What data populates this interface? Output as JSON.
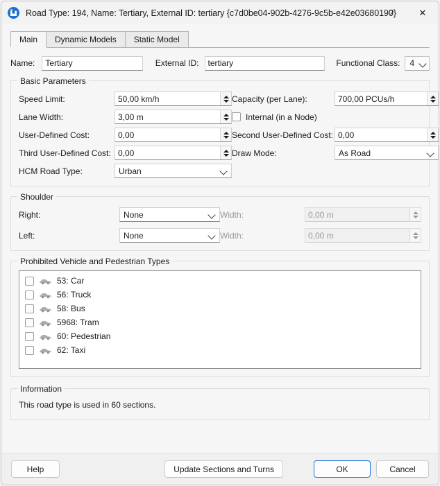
{
  "window": {
    "title": "Road Type: 194, Name: Tertiary, External ID: tertiary  {c7d0be04-902b-4276-9c5b-e42e03680190}",
    "app_icon": "aimsun-app-icon",
    "help_button": "?",
    "close_button": "✕"
  },
  "tabs": [
    {
      "label": "Main",
      "active": true
    },
    {
      "label": "Dynamic Models",
      "active": false
    },
    {
      "label": "Static Model",
      "active": false
    }
  ],
  "top_row": {
    "name_label": "Name:",
    "name_value": "Tertiary",
    "external_id_label": "External ID:",
    "external_id_value": "tertiary",
    "functional_class_label": "Functional Class:",
    "functional_class_value": "4"
  },
  "basic_parameters": {
    "title": "Basic Parameters",
    "speed_limit_label": "Speed Limit:",
    "speed_limit_value": "50,00 km/h",
    "capacity_label": "Capacity (per Lane):",
    "capacity_value": "700,00 PCUs/h",
    "lane_width_label": "Lane Width:",
    "lane_width_value": "3,00 m",
    "internal_label": "Internal (in a Node)",
    "internal_checked": false,
    "user_defined_cost_label": "User-Defined Cost:",
    "user_defined_cost_value": "0,00",
    "second_user_defined_cost_label": "Second User-Defined Cost:",
    "second_user_defined_cost_value": "0,00",
    "third_user_defined_cost_label": "Third User-Defined Cost:",
    "third_user_defined_cost_value": "0,00",
    "draw_mode_label": "Draw Mode:",
    "draw_mode_value": "As Road",
    "hcm_road_type_label": "HCM Road Type:",
    "hcm_road_type_value": "Urban"
  },
  "shoulder": {
    "title": "Shoulder",
    "right_label": "Right:",
    "right_value": "None",
    "right_width_label": "Width:",
    "right_width_value": "0,00 m",
    "left_label": "Left:",
    "left_value": "None",
    "left_width_label": "Width:",
    "left_width_value": "0,00 m"
  },
  "prohibited": {
    "title": "Prohibited Vehicle and Pedestrian Types",
    "items": [
      {
        "label": "53: Car",
        "checked": false,
        "icon": "vehicle-icon"
      },
      {
        "label": "56: Truck",
        "checked": false,
        "icon": "vehicle-icon"
      },
      {
        "label": "58: Bus",
        "checked": false,
        "icon": "vehicle-icon"
      },
      {
        "label": "5968: Tram",
        "checked": false,
        "icon": "vehicle-icon"
      },
      {
        "label": "60: Pedestrian",
        "checked": false,
        "icon": "vehicle-icon"
      },
      {
        "label": "62: Taxi",
        "checked": false,
        "icon": "vehicle-icon"
      }
    ]
  },
  "information": {
    "title": "Information",
    "text": "This road type is used in 60 sections."
  },
  "footer": {
    "help_label": "Help",
    "update_label": "Update Sections and Turns",
    "ok_label": "OK",
    "cancel_label": "Cancel"
  },
  "colors": {
    "accent": "#1a73d4",
    "dialog_bg": "#f6f6f6",
    "footer_bg": "#f0f0f0",
    "text": "#1b1b1b",
    "disabled_text": "#9a9a9a"
  }
}
